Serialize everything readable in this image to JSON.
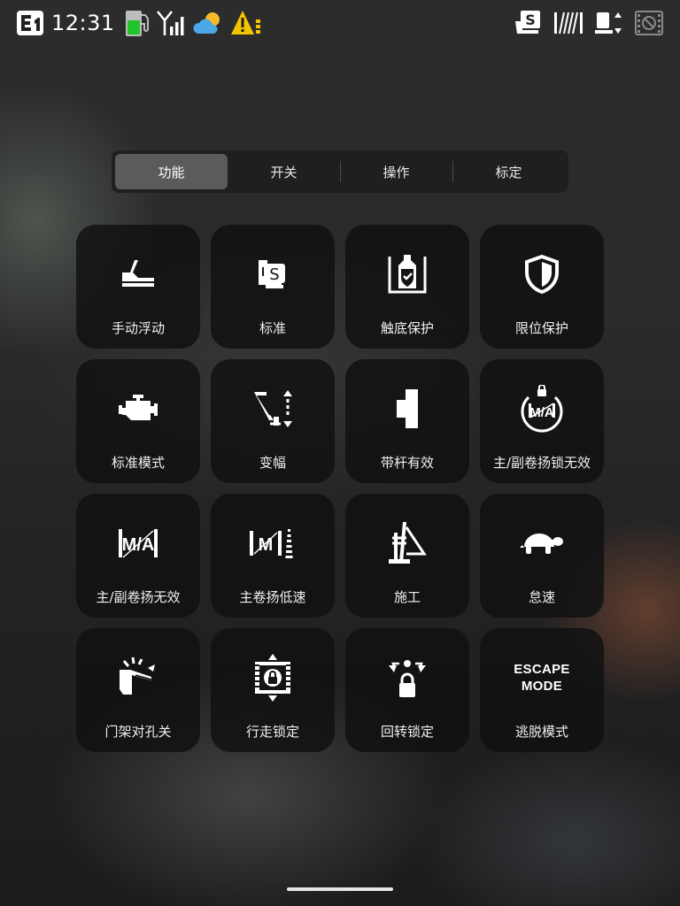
{
  "status_bar": {
    "time": "12:31",
    "left_icons": [
      "e1-icon",
      "fuel-gauge-icon",
      "signal-icon",
      "weather-cloud-sun-icon",
      "warning-icon"
    ],
    "right_icons": [
      "seat-s-icon",
      "hatched-bar-icon",
      "machine-updown-icon",
      "camera-disabled-icon"
    ],
    "warning_color": "#f5c400",
    "fuel_color": "#21c42b",
    "weather_sun_color": "#f7b82a",
    "weather_cloud_color": "#4aa8e8"
  },
  "tabs": [
    {
      "label": "功能",
      "active": true
    },
    {
      "label": "开关",
      "active": false
    },
    {
      "label": "操作",
      "active": false
    },
    {
      "label": "标定",
      "active": false
    }
  ],
  "tiles": [
    {
      "label": "手动浮动",
      "icon": "manual-float-icon"
    },
    {
      "label": "标准",
      "icon": "standard-seat-s-icon"
    },
    {
      "label": "触底保护",
      "icon": "bottom-protection-icon"
    },
    {
      "label": "限位保护",
      "icon": "limit-shield-icon"
    },
    {
      "label": "标准模式",
      "icon": "engine-icon"
    },
    {
      "label": "变幅",
      "icon": "luffing-boom-icon"
    },
    {
      "label": "带杆有效",
      "icon": "rod-valid-icon"
    },
    {
      "label": "主/副卷扬锁无效",
      "icon": "winch-lock-invalid-icon"
    },
    {
      "label": "主/副卷扬无效",
      "icon": "winch-ma-invalid-icon"
    },
    {
      "label": "主卷扬低速",
      "icon": "main-winch-low-speed-icon"
    },
    {
      "label": "施工",
      "icon": "construction-icon"
    },
    {
      "label": "怠速",
      "icon": "turtle-idle-icon"
    },
    {
      "label": "门架对孔关",
      "icon": "mast-alignment-off-icon"
    },
    {
      "label": "行走锁定",
      "icon": "travel-lock-icon"
    },
    {
      "label": "回转锁定",
      "icon": "slew-lock-icon"
    },
    {
      "label": "逃脱模式",
      "icon": "escape-mode-icon",
      "icon_text_line1": "ESCAPE",
      "icon_text_line2": "MODE"
    }
  ]
}
